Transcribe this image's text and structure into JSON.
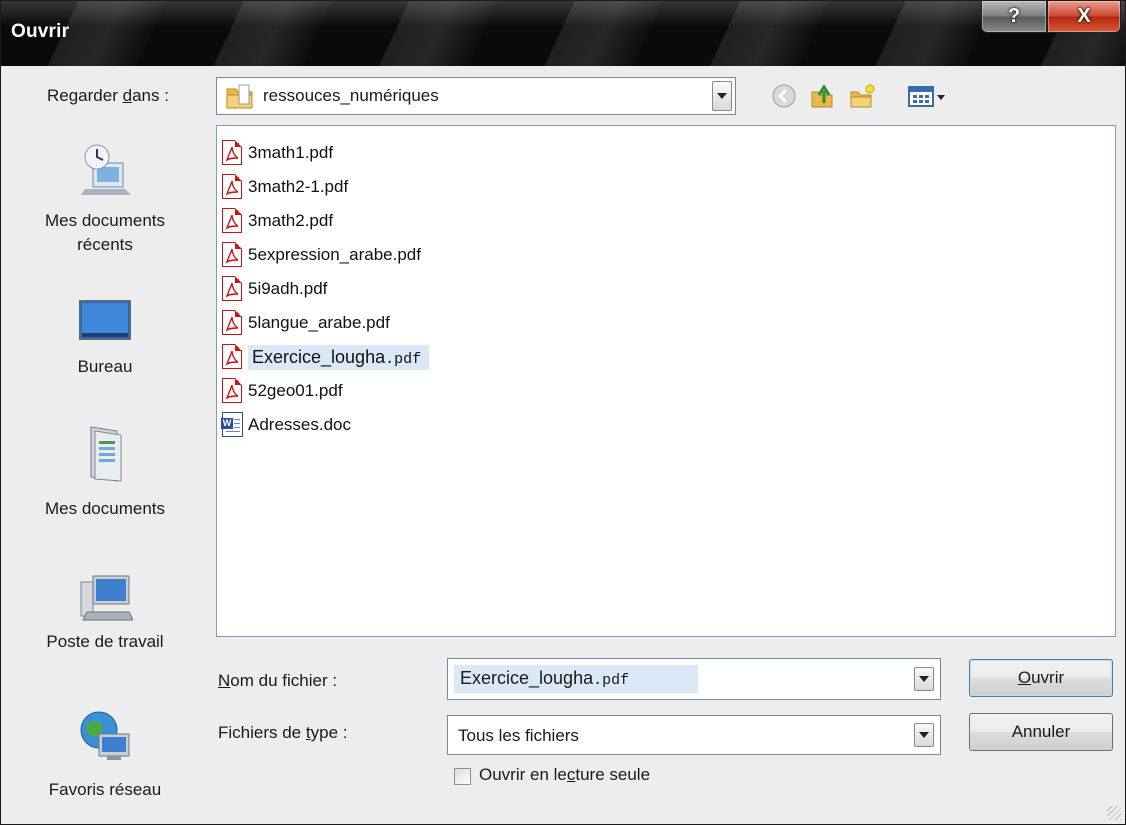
{
  "window": {
    "title": "Ouvrir",
    "help_glyph": "?",
    "close_glyph": "X"
  },
  "look_in": {
    "label_pre": "Regarder ",
    "label_ul": "d",
    "label_post": "ans :",
    "value": "ressouces_numériques"
  },
  "places": [
    {
      "id": "recent",
      "icon": "recent-documents-icon",
      "label_line1": "Mes documents",
      "label_line2": "récents"
    },
    {
      "id": "desktop",
      "icon": "desktop-icon",
      "label_line1": "Bureau",
      "label_line2": ""
    },
    {
      "id": "documents",
      "icon": "my-documents-icon",
      "label_line1": "Mes documents",
      "label_line2": ""
    },
    {
      "id": "computer",
      "icon": "my-computer-icon",
      "label_line1": "Poste de travail",
      "label_line2": ""
    },
    {
      "id": "network",
      "icon": "network-places-icon",
      "label_line1": "Favoris réseau",
      "label_line2": ""
    }
  ],
  "files": [
    {
      "name": "3math1.pdf",
      "type": "pdf"
    },
    {
      "name": "3math2-1.pdf",
      "type": "pdf"
    },
    {
      "name": "3math2.pdf",
      "type": "pdf"
    },
    {
      "name": "5expression_arabe.pdf",
      "type": "pdf"
    },
    {
      "name": "5i9adh.pdf",
      "type": "pdf"
    },
    {
      "name": "5langue_arabe.pdf",
      "type": "pdf"
    },
    {
      "name": "Exercice_lougha",
      "ext": ".pdf",
      "type": "pdf",
      "selected": true
    },
    {
      "name": "52geo01.pdf",
      "type": "pdf"
    },
    {
      "name": "Adresses.doc",
      "type": "doc"
    }
  ],
  "filename": {
    "label_ul": "N",
    "label_post": "om du fichier :",
    "value": "Exercice_lougha",
    "ext": ".pdf"
  },
  "filetype": {
    "label_pre": "Fichiers de ",
    "label_ul": "t",
    "label_post": "ype :",
    "value": "Tous les fichiers"
  },
  "readonly": {
    "label_pre": "Ouvrir en le",
    "label_ul": "c",
    "label_post": "ture seule",
    "checked": false
  },
  "buttons": {
    "open_ul": "O",
    "open_post": "uvrir",
    "cancel": "Annuler"
  },
  "colors": {
    "selection": "#dbe8f7",
    "pdf_red": "#c91414",
    "close_red": "#c9462f"
  }
}
